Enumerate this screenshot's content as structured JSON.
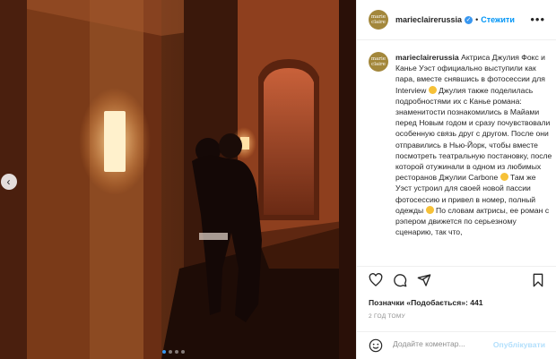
{
  "post": {
    "username": "marieclairerussia",
    "follow_label": "Стежити",
    "avatar_text_line1": "marie",
    "avatar_text_line2": "claire",
    "caption_prefix": "marieclairerussia",
    "caption_p1": " Актриса Джулия Фокс и Канье Уэст официально выступили как пара, вместе снявшись в фотосессии для Interview ",
    "caption_p2": " Джулия также поделилась подробностями их с Канье романа: знаменитости познакомились в Майами перед Новым годом и сразу почувствовали особенную связь друг с другом. После они отправились в Нью-Йорк, чтобы вместе посмотреть театральную постановку, после которой отужинали в одном из любимых ресторанов Джулии Carbone ",
    "caption_p3": " Там же Уэст устроил для своей новой пассии фотосессию и привел в номер, полный одежды ",
    "caption_p4": " По словам актрисы, ее роман с рэпером движется по серьезному сценарию, так что,",
    "likes_label": "Позначки «Подобається»: 441",
    "time_label": "2 ГОД ТОМУ",
    "comment_placeholder": "Додайте коментар...",
    "publish_label": "Опублікувати"
  },
  "carousel": {
    "total": 4,
    "active_index": 0
  },
  "icons": [
    "chevron-left-icon",
    "verified-icon",
    "more-icon",
    "heart-icon",
    "comment-icon",
    "share-icon",
    "bookmark-icon",
    "smile-icon"
  ],
  "colors": {
    "accent": "#0095f6",
    "verified": "#3897f0",
    "publish_disabled": "#b2dffc",
    "text": "#262626",
    "muted": "#8e8e8e"
  }
}
